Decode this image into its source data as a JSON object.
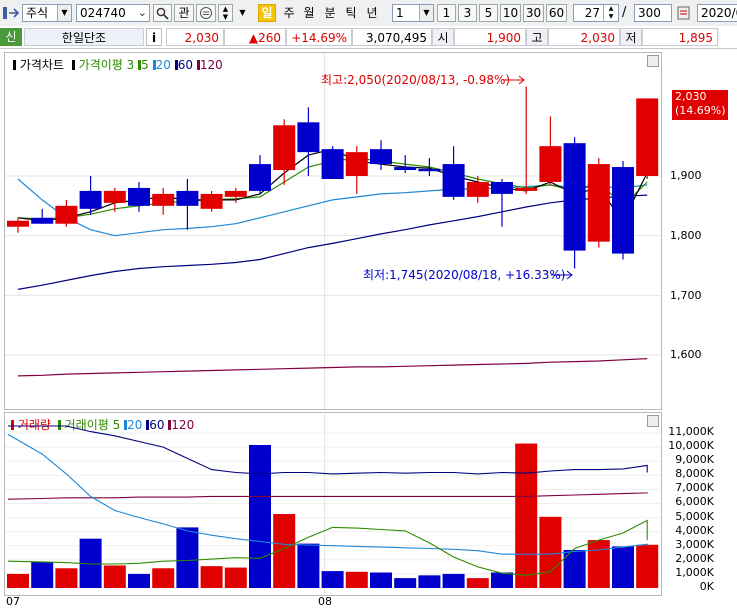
{
  "toolbar": {
    "market_select": "주식",
    "code_input": "024740",
    "btn_gwan": "관",
    "tab_il": "일",
    "tab_ju": "주",
    "tab_wol": "월",
    "tab_bun": "분",
    "tab_tik": "틱",
    "tab_nyeon": "년",
    "unit_select": "1",
    "periods": [
      "1",
      "3",
      "5",
      "10",
      "30",
      "60"
    ],
    "count_input": "27",
    "count_sep": "/",
    "count_total": "300",
    "date_input": "2020/0"
  },
  "quote": {
    "badge": "신",
    "name": "한일단조",
    "info_btn": "i",
    "price": "2,030",
    "change": "▲260",
    "change_pct": "+14.69%",
    "volume": "3,070,495",
    "open_label": "시",
    "open_value": "1,900",
    "high_label": "고",
    "high_value": "2,030",
    "low_label": "저",
    "low_value": "1,895"
  },
  "price_panel": {
    "legend_title": "가격차트",
    "legend_ma_title": "가격이평",
    "legend_ma_values": [
      "3",
      "5",
      "20",
      "60",
      "120"
    ],
    "annotation_high": "최고:2,050(2020/08/13, -0.98%)",
    "annotation_low": "최저:1,745(2020/08/18, +16.33%)",
    "axis_labels": [
      "1,900",
      "1,800",
      "1,700",
      "1,600"
    ],
    "current_price_tag": "2,030",
    "current_pct_tag": "(14.69%)"
  },
  "volume_panel": {
    "legend_title": "거래량",
    "legend_ma_title": "거래이평",
    "legend_ma_values": [
      "5",
      "20",
      "60",
      "120"
    ],
    "axis_labels": [
      "11,000K",
      "10,000K",
      "9,000K",
      "8,000K",
      "7,000K",
      "6,000K",
      "5,000K",
      "4,000K",
      "3,000K",
      "2,000K",
      "1,000K",
      "0K"
    ],
    "x_labels": [
      "07",
      "08"
    ]
  },
  "colors": {
    "up": "#e00000",
    "down": "#0000cc",
    "ma3": "#000000",
    "ma5": "#2f8a00",
    "ma20": "#1e88d8",
    "ma60": "#000080",
    "ma120": "#800040"
  },
  "chart_data": {
    "type": "candlestick",
    "x_labels": [
      "07",
      "08"
    ],
    "y_ticks_price": [
      1600,
      1700,
      1800,
      1900
    ],
    "y_ticks_volume_k": [
      0,
      1000,
      2000,
      3000,
      4000,
      5000,
      6000,
      7000,
      8000,
      9000,
      10000,
      11000
    ],
    "candles": [
      {
        "o": 1815,
        "h": 1830,
        "l": 1805,
        "c": 1825,
        "v": 1000
      },
      {
        "o": 1830,
        "h": 1845,
        "l": 1820,
        "c": 1820,
        "v": 1850
      },
      {
        "o": 1820,
        "h": 1860,
        "l": 1815,
        "c": 1850,
        "v": 1400
      },
      {
        "o": 1875,
        "h": 1900,
        "l": 1835,
        "c": 1845,
        "v": 3500
      },
      {
        "o": 1855,
        "h": 1880,
        "l": 1840,
        "c": 1875,
        "v": 1600
      },
      {
        "o": 1880,
        "h": 1890,
        "l": 1840,
        "c": 1850,
        "v": 1000
      },
      {
        "o": 1850,
        "h": 1880,
        "l": 1835,
        "c": 1870,
        "v": 1400
      },
      {
        "o": 1875,
        "h": 1895,
        "l": 1810,
        "c": 1850,
        "v": 4300
      },
      {
        "o": 1845,
        "h": 1875,
        "l": 1840,
        "c": 1870,
        "v": 1550
      },
      {
        "o": 1865,
        "h": 1880,
        "l": 1855,
        "c": 1875,
        "v": 1450
      },
      {
        "o": 1920,
        "h": 1935,
        "l": 1870,
        "c": 1875,
        "v": 10150
      },
      {
        "o": 1910,
        "h": 1995,
        "l": 1885,
        "c": 1985,
        "v": 5250
      },
      {
        "o": 1990,
        "h": 2015,
        "l": 1900,
        "c": 1940,
        "v": 3150
      },
      {
        "o": 1945,
        "h": 1950,
        "l": 1895,
        "c": 1895,
        "v": 1200
      },
      {
        "o": 1900,
        "h": 1950,
        "l": 1870,
        "c": 1940,
        "v": 1150
      },
      {
        "o": 1945,
        "h": 1960,
        "l": 1910,
        "c": 1920,
        "v": 1100
      },
      {
        "o": 1915,
        "h": 1935,
        "l": 1905,
        "c": 1910,
        "v": 700
      },
      {
        "o": 1912,
        "h": 1930,
        "l": 1900,
        "c": 1908,
        "v": 900
      },
      {
        "o": 1920,
        "h": 1950,
        "l": 1860,
        "c": 1865,
        "v": 1000
      },
      {
        "o": 1865,
        "h": 1900,
        "l": 1855,
        "c": 1890,
        "v": 700
      },
      {
        "o": 1890,
        "h": 1895,
        "l": 1815,
        "c": 1870,
        "v": 1100
      },
      {
        "o": 1875,
        "h": 2050,
        "l": 1870,
        "c": 1880,
        "v": 10250
      },
      {
        "o": 1890,
        "h": 2000,
        "l": 1885,
        "c": 1950,
        "v": 5050
      },
      {
        "o": 1955,
        "h": 1965,
        "l": 1745,
        "c": 1775,
        "v": 2700
      },
      {
        "o": 1790,
        "h": 1930,
        "l": 1780,
        "c": 1920,
        "v": 3400
      },
      {
        "o": 1915,
        "h": 1925,
        "l": 1760,
        "c": 1770,
        "v": 2950
      },
      {
        "o": 1900,
        "h": 2030,
        "l": 1895,
        "c": 2030,
        "v": 3070
      }
    ],
    "ma_price": {
      "ma3": [
        1830,
        1825,
        1830,
        1840,
        1855,
        1860,
        1865,
        1860,
        1860,
        1860,
        1870,
        1905,
        1935,
        1945,
        1925,
        1920,
        1915,
        1913,
        1900,
        1890,
        1880,
        1875,
        1890,
        1870,
        1880,
        1825,
        1905
      ],
      "ma5": [
        1830,
        1828,
        1830,
        1836,
        1845,
        1850,
        1855,
        1858,
        1860,
        1862,
        1865,
        1890,
        1915,
        1925,
        1930,
        1925,
        1920,
        1915,
        1905,
        1895,
        1887,
        1880,
        1885,
        1875,
        1890,
        1850,
        1890
      ],
      "ma20": [
        1895,
        1860,
        1830,
        1810,
        1800,
        1805,
        1810,
        1812,
        1815,
        1820,
        1830,
        1840,
        1850,
        1860,
        1865,
        1870,
        1872,
        1875,
        1878,
        1878,
        1880,
        1882,
        1885,
        1880,
        1882,
        1880,
        1885
      ],
      "ma60": [
        1710,
        1717,
        1725,
        1733,
        1740,
        1745,
        1748,
        1750,
        1752,
        1755,
        1760,
        1770,
        1780,
        1787,
        1795,
        1803,
        1810,
        1818,
        1825,
        1832,
        1840,
        1848,
        1855,
        1860,
        1863,
        1866,
        1868
      ],
      "ma120": [
        1565,
        1566,
        1568,
        1569,
        1570,
        1571,
        1572,
        1573,
        1574,
        1575,
        1576,
        1577,
        1578,
        1579,
        1580,
        1580,
        1581,
        1582,
        1583,
        1584,
        1585,
        1586,
        1588,
        1589,
        1590,
        1592,
        1594
      ]
    },
    "ma_volume_k": {
      "ma5": [
        1900,
        1850,
        1800,
        1700,
        1700,
        1750,
        1900,
        1950,
        2050,
        2150,
        2100,
        2800,
        3600,
        4300,
        4250,
        4150,
        4050,
        3200,
        2200,
        1500,
        1050,
        900,
        1150,
        2800,
        3400,
        3900,
        4800,
        3400
      ],
      "ma20": [
        10900,
        9500,
        8100,
        6500,
        5500,
        5000,
        4550,
        4050,
        3750,
        3500,
        3300,
        3100,
        3050,
        3000,
        2950,
        2900,
        2850,
        2800,
        2750,
        2650,
        2400,
        2400,
        2400,
        2600,
        2700,
        2900,
        3100,
        3000
      ],
      "ma60": [
        11500,
        11500,
        11500,
        11100,
        10800,
        10400,
        10000,
        9200,
        8400,
        8200,
        8100,
        8200,
        8200,
        8100,
        8150,
        8200,
        8150,
        8200,
        8200,
        8100,
        8200,
        8150,
        8300,
        8400,
        8400,
        8450,
        8700,
        8200
      ],
      "ma120": [
        6300,
        6350,
        6400,
        6400,
        6400,
        6450,
        6450,
        6450,
        6500,
        6500,
        6500,
        6500,
        6500,
        6500,
        6500,
        6500,
        6500,
        6500,
        6500,
        6500,
        6500,
        6500,
        6550,
        6600,
        6650,
        6700,
        6750,
        6800
      ]
    }
  }
}
